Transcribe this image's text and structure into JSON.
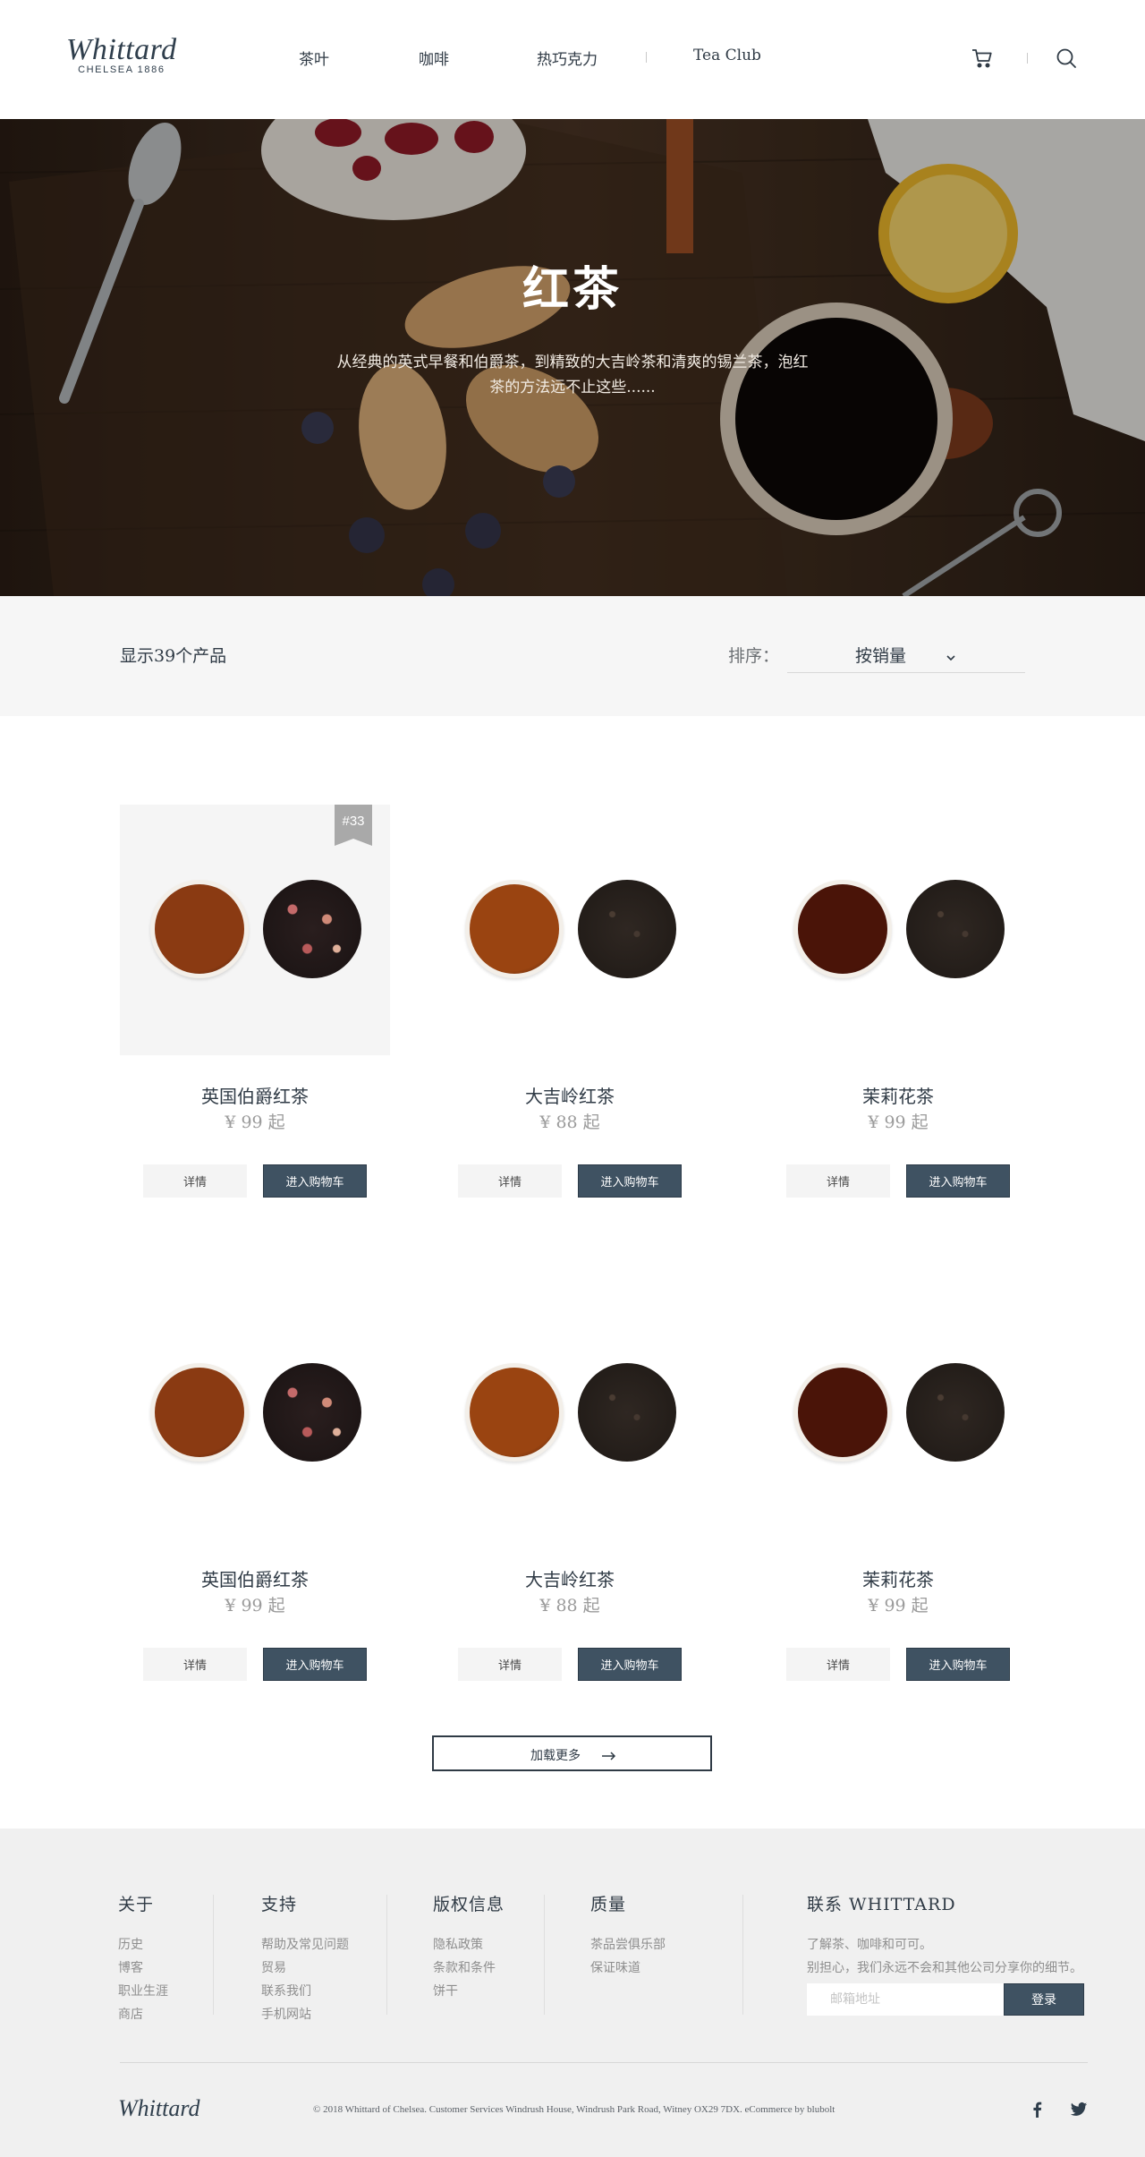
{
  "brand": {
    "name": "Whittard",
    "tagline": "CHELSEA 1886"
  },
  "nav": {
    "items": [
      "茶叶",
      "咖啡",
      "热巧克力",
      "Tea Club"
    ]
  },
  "hero": {
    "title": "红茶",
    "description": "从经典的英式早餐和伯爵茶，到精致的大吉岭茶和清爽的锡兰茶，泡红茶的方法远不止这些......"
  },
  "filter": {
    "count_label": "显示39个产品",
    "sort_label": "排序：",
    "sort_value": "按销量"
  },
  "products": [
    {
      "name": "英国伯爵红茶",
      "price": "¥ 99 起",
      "rank": "#33",
      "detail_label": "详情",
      "cart_label": "进入购物车",
      "liquid_color": "#8a3a12",
      "leaf_style": "rose"
    },
    {
      "name": "大吉岭红茶",
      "price": "¥ 88 起",
      "detail_label": "详情",
      "cart_label": "进入购物车",
      "liquid_color": "#9a4411",
      "leaf_style": "dark"
    },
    {
      "name": "茉莉花茶",
      "price": "¥ 99 起",
      "detail_label": "详情",
      "cart_label": "进入购物车",
      "liquid_color": "#4a1408",
      "leaf_style": "dark"
    },
    {
      "name": "英国伯爵红茶",
      "price": "¥ 99 起",
      "detail_label": "详情",
      "cart_label": "进入购物车",
      "liquid_color": "#8a3a12",
      "leaf_style": "rose"
    },
    {
      "name": "大吉岭红茶",
      "price": "¥ 88 起",
      "detail_label": "详情",
      "cart_label": "进入购物车",
      "liquid_color": "#9a4411",
      "leaf_style": "dark"
    },
    {
      "name": "茉莉花茶",
      "price": "¥ 99 起",
      "detail_label": "详情",
      "cart_label": "进入购物车",
      "liquid_color": "#4a1408",
      "leaf_style": "dark"
    }
  ],
  "load_more": {
    "label": "加载更多"
  },
  "footer": {
    "columns": [
      {
        "title": "关于",
        "items": [
          "历史",
          "博客",
          "职业生涯",
          "商店"
        ]
      },
      {
        "title": "支持",
        "items": [
          "帮助及常见问题",
          "贸易",
          "联系我们",
          "手机网站"
        ]
      },
      {
        "title": "版权信息",
        "items": [
          "隐私政策",
          "条款和条件",
          "饼干"
        ]
      },
      {
        "title": "质量",
        "items": [
          "茶品尝俱乐部",
          "保证味道"
        ]
      }
    ],
    "contact": {
      "title": "联系  WHITTARD",
      "line1": "了解茶、咖啡和可可。",
      "line2": "别担心，我们永远不会和其他公司分享你的细节。",
      "email_placeholder": "邮箱地址",
      "login_label": "登录"
    },
    "logo": "Whittard",
    "copyright": "© 2018 Whittard of Chelsea. Customer Services Windrush House, Windrush Park Road, Witney OX29 7DX. eCommerce by blubolt"
  },
  "icons": {
    "cart": "cart-icon",
    "search": "search-icon",
    "facebook": "facebook-icon",
    "twitter": "twitter-icon",
    "sort": "chevron-down-icon",
    "arrow": "arrow-right-icon"
  },
  "colors": {
    "accent": "#3f5262",
    "text": "#2f3a45",
    "muted": "#9b9b9b",
    "footer_bg": "#f0f0f0",
    "filter_bg": "#f6f6f6"
  }
}
